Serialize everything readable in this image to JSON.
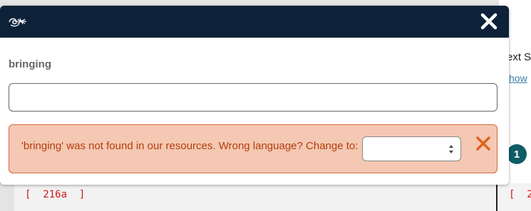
{
  "background": {
    "text_s": "ext S",
    "show_link": "how",
    "step_number": "1",
    "ref_left": "[  216a  ]",
    "ref_right": "[  21"
  },
  "modal": {
    "word": "bringing",
    "input": {
      "value": "",
      "placeholder": ""
    },
    "alert": {
      "message": "'bringing' was not found in our resources. Wrong language? Change to:",
      "selected_language": ""
    }
  },
  "icons": {
    "logo": "logo-icon",
    "close": "close-icon",
    "alert_close": "close-icon",
    "select_arrows": "updown-arrows-icon"
  },
  "colors": {
    "header": "#0d2238",
    "alert_bg": "#f4c8b2",
    "alert_text": "#b43d0f",
    "alert_close": "#e0631f",
    "ref_text": "#cc1a1a",
    "step_circle": "#0f5c66"
  }
}
